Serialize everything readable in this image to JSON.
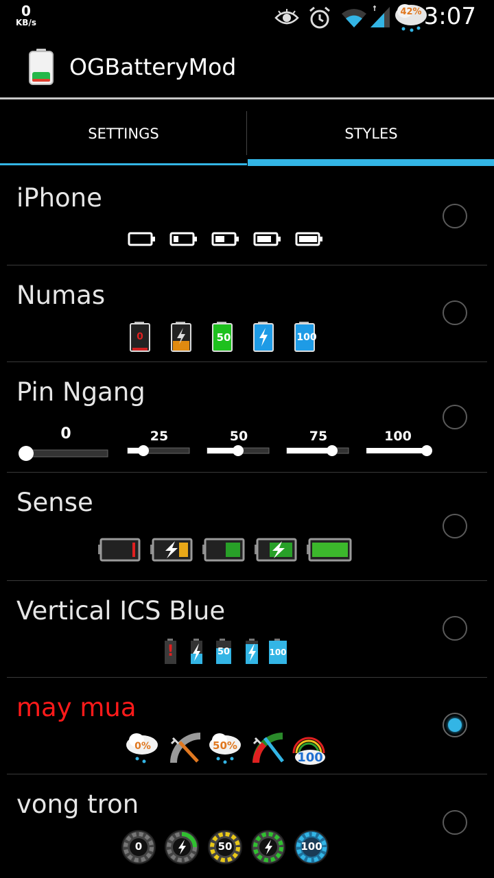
{
  "status_bar": {
    "speed_value": "0",
    "speed_unit": "KB/s",
    "weather_percent": "42%",
    "time": "3:07"
  },
  "app": {
    "title": "OGBatteryMod"
  },
  "tabs": [
    {
      "label": "SETTINGS",
      "selected": false
    },
    {
      "label": "STYLES",
      "selected": true
    }
  ],
  "styles": [
    {
      "name": "iPhone",
      "selected": false
    },
    {
      "name": "Numas",
      "selected": false,
      "levels": [
        "0",
        "50",
        "100"
      ]
    },
    {
      "name": "Pin Ngang",
      "selected": false,
      "levels": [
        "0",
        "25",
        "50",
        "75",
        "100"
      ]
    },
    {
      "name": "Sense",
      "selected": false
    },
    {
      "name": "Vertical ICS Blue",
      "selected": false,
      "levels": [
        "!",
        "50",
        "100"
      ]
    },
    {
      "name": "may mua",
      "selected": true,
      "levels": [
        "0%",
        "50%",
        "100"
      ]
    },
    {
      "name": "vong tron",
      "selected": false,
      "levels": [
        "0",
        "50",
        "100"
      ]
    }
  ],
  "colors": {
    "accent": "#33b5e5",
    "selected_title": "#ff1a1a"
  }
}
